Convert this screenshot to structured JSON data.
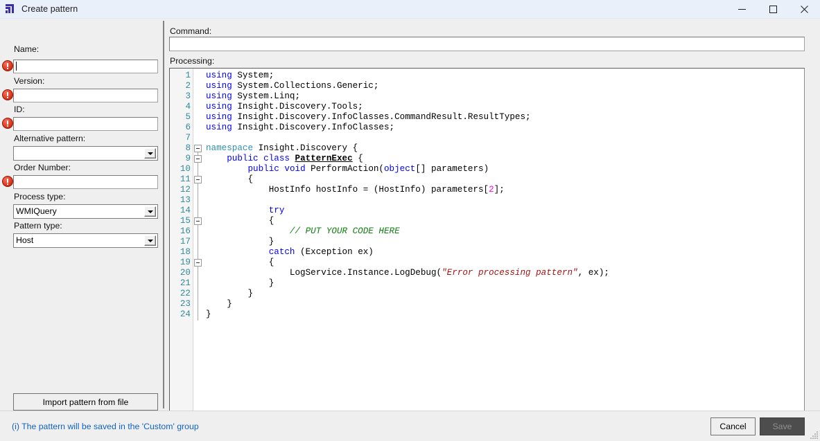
{
  "window": {
    "title": "Create pattern",
    "icon": "app-logo-icon",
    "controls": {
      "minimize": "minimize-icon",
      "maximize": "maximize-icon",
      "close": "close-icon"
    }
  },
  "left_panel": {
    "fields": [
      {
        "label": "Name:",
        "value": "",
        "required": true,
        "type": "text",
        "focused": true
      },
      {
        "label": "Version:",
        "value": "",
        "required": true,
        "type": "text",
        "focused": false
      },
      {
        "label": "ID:",
        "value": "",
        "required": true,
        "type": "text",
        "focused": false
      },
      {
        "label": "Alternative pattern:",
        "value": "",
        "required": false,
        "type": "combo",
        "focused": false
      },
      {
        "label": "Order Number:",
        "value": "",
        "required": true,
        "type": "text",
        "focused": false
      },
      {
        "label": "Process type:",
        "value": "WMIQuery",
        "required": false,
        "type": "combo",
        "focused": false
      },
      {
        "label": "Pattern type:",
        "value": "Host",
        "required": false,
        "type": "combo",
        "focused": false
      }
    ],
    "import_button": "Import pattern from file",
    "info_note": "(i) The pattern will be saved in the 'Custom' group"
  },
  "right_panel": {
    "command_label": "Command:",
    "command_value": "",
    "command_placeholder": "",
    "processing_label": "Processing:"
  },
  "editor": {
    "line_numbers": [
      1,
      2,
      3,
      4,
      5,
      6,
      7,
      8,
      9,
      10,
      11,
      12,
      13,
      14,
      15,
      16,
      17,
      18,
      19,
      20,
      21,
      22,
      23,
      24
    ],
    "lines": [
      [
        {
          "t": "using",
          "c": "kw"
        },
        {
          "t": " System;",
          "c": ""
        }
      ],
      [
        {
          "t": "using",
          "c": "kw"
        },
        {
          "t": " System.Collections.Generic;",
          "c": ""
        }
      ],
      [
        {
          "t": "using",
          "c": "kw"
        },
        {
          "t": " System.Linq;",
          "c": ""
        }
      ],
      [
        {
          "t": "using",
          "c": "kw"
        },
        {
          "t": " Insight.Discovery.Tools;",
          "c": ""
        }
      ],
      [
        {
          "t": "using",
          "c": "kw"
        },
        {
          "t": " Insight.Discovery.InfoClasses.CommandResult.ResultTypes;",
          "c": ""
        }
      ],
      [
        {
          "t": "using",
          "c": "kw"
        },
        {
          "t": " Insight.Discovery.InfoClasses;",
          "c": ""
        }
      ],
      [
        {
          "t": "",
          "c": ""
        }
      ],
      [
        {
          "t": "namespace",
          "c": "kw2"
        },
        {
          "t": " Insight.Discovery {",
          "c": ""
        }
      ],
      [
        {
          "t": "    ",
          "c": ""
        },
        {
          "t": "public",
          "c": "kw"
        },
        {
          "t": " ",
          "c": ""
        },
        {
          "t": "class",
          "c": "kw"
        },
        {
          "t": " ",
          "c": ""
        },
        {
          "t": "PatternExec",
          "c": "cls"
        },
        {
          "t": " {",
          "c": ""
        }
      ],
      [
        {
          "t": "        ",
          "c": ""
        },
        {
          "t": "public",
          "c": "kw"
        },
        {
          "t": " ",
          "c": ""
        },
        {
          "t": "void",
          "c": "kw"
        },
        {
          "t": " PerformAction(",
          "c": ""
        },
        {
          "t": "object",
          "c": "kw"
        },
        {
          "t": "[] parameters)",
          "c": ""
        }
      ],
      [
        {
          "t": "        {",
          "c": ""
        }
      ],
      [
        {
          "t": "            HostInfo hostInfo = (HostInfo) parameters[",
          "c": ""
        },
        {
          "t": "2",
          "c": "num"
        },
        {
          "t": "];",
          "c": ""
        }
      ],
      [
        {
          "t": "",
          "c": ""
        }
      ],
      [
        {
          "t": "            ",
          "c": ""
        },
        {
          "t": "try",
          "c": "kw"
        }
      ],
      [
        {
          "t": "            {",
          "c": ""
        }
      ],
      [
        {
          "t": "                ",
          "c": ""
        },
        {
          "t": "// PUT YOUR CODE HERE",
          "c": "cmt"
        }
      ],
      [
        {
          "t": "            }",
          "c": ""
        }
      ],
      [
        {
          "t": "            ",
          "c": ""
        },
        {
          "t": "catch",
          "c": "kw"
        },
        {
          "t": " (Exception ex)",
          "c": ""
        }
      ],
      [
        {
          "t": "            {",
          "c": ""
        }
      ],
      [
        {
          "t": "                LogService.Instance.LogDebug(",
          "c": ""
        },
        {
          "t": "\"Error processing pattern\"",
          "c": "str"
        },
        {
          "t": ", ex);",
          "c": ""
        }
      ],
      [
        {
          "t": "            }",
          "c": ""
        }
      ],
      [
        {
          "t": "        }",
          "c": ""
        }
      ],
      [
        {
          "t": "    }",
          "c": ""
        }
      ],
      [
        {
          "t": "}",
          "c": ""
        }
      ]
    ],
    "fold_markers": [
      8,
      9,
      11,
      15,
      19
    ]
  },
  "footer": {
    "cancel_label": "Cancel",
    "save_label": "Save",
    "save_disabled": true
  },
  "colors": {
    "titlebar_bg": "#eaf0fa",
    "window_bg": "#efefef",
    "accent_logo": "#3a2db0",
    "error_red": "#e23a22",
    "link_blue": "#1162c4",
    "keyword_blue": "#0000ff",
    "type_teal": "#2b91af",
    "string_red": "#a31515",
    "comment_green": "#108010",
    "number_magenta": "#ff00ff",
    "linenum_teal": "#2e8b9c",
    "save_disabled_bg": "#4d4d4d"
  }
}
